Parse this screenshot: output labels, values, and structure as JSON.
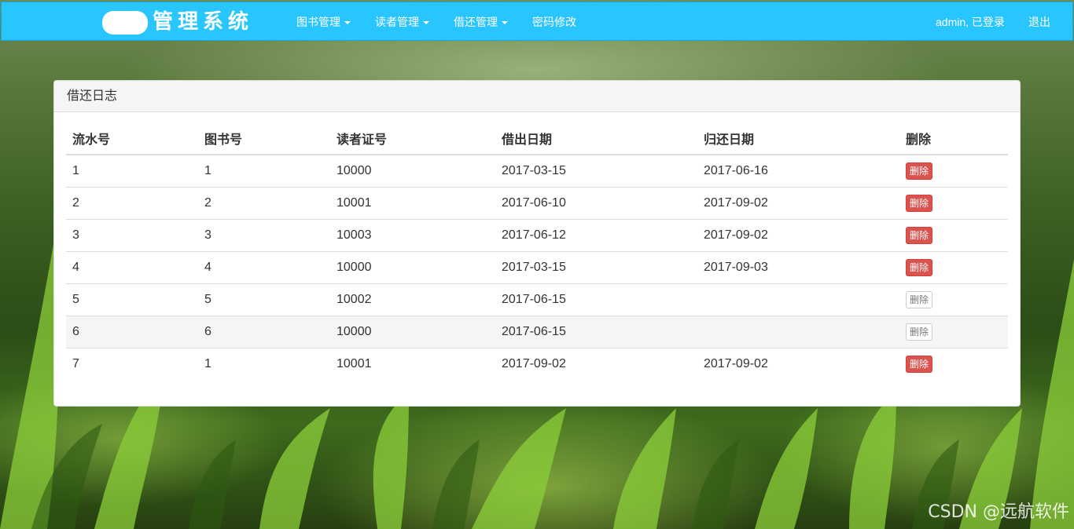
{
  "navbar": {
    "brand": "管理系统",
    "menus": [
      {
        "label": "图书管理",
        "dropdown": true
      },
      {
        "label": "读者管理",
        "dropdown": true
      },
      {
        "label": "借还管理",
        "dropdown": true
      },
      {
        "label": "密码修改",
        "dropdown": false
      }
    ],
    "user_status": "admin, 已登录",
    "logout": "退出"
  },
  "panel": {
    "title": "借还日志",
    "columns": [
      "流水号",
      "图书号",
      "读者证号",
      "借出日期",
      "归还日期",
      "删除"
    ],
    "rows": [
      {
        "id": "1",
        "book": "1",
        "reader": "10000",
        "lend": "2017-03-15",
        "back": "2017-06-16",
        "action": "删除",
        "enabled": true
      },
      {
        "id": "2",
        "book": "2",
        "reader": "10001",
        "lend": "2017-06-10",
        "back": "2017-09-02",
        "action": "删除",
        "enabled": true
      },
      {
        "id": "3",
        "book": "3",
        "reader": "10003",
        "lend": "2017-06-12",
        "back": "2017-09-02",
        "action": "删除",
        "enabled": true
      },
      {
        "id": "4",
        "book": "4",
        "reader": "10000",
        "lend": "2017-03-15",
        "back": "2017-09-03",
        "action": "删除",
        "enabled": true
      },
      {
        "id": "5",
        "book": "5",
        "reader": "10002",
        "lend": "2017-06-15",
        "back": "",
        "action": "删除",
        "enabled": false
      },
      {
        "id": "6",
        "book": "6",
        "reader": "10000",
        "lend": "2017-06-15",
        "back": "",
        "action": "删除",
        "enabled": false
      },
      {
        "id": "7",
        "book": "1",
        "reader": "10001",
        "lend": "2017-09-02",
        "back": "2017-09-02",
        "action": "删除",
        "enabled": true
      }
    ]
  },
  "watermark": "CSDN @远航软件",
  "colors": {
    "navbar": "#29c5ff",
    "danger": "#d9534f"
  }
}
